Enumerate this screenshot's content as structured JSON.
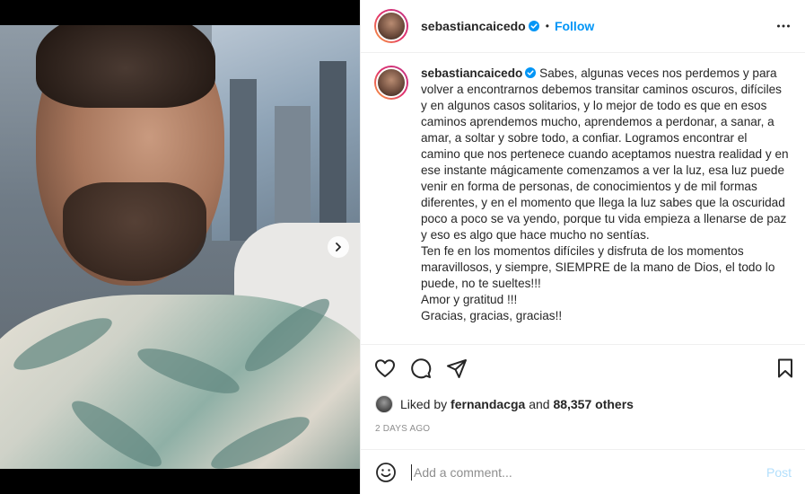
{
  "post": {
    "username": "sebastiancaicedo",
    "verified_icon": "verified-badge-icon",
    "separator": "•",
    "follow_label": "Follow",
    "more_icon": "more-horizontal-icon",
    "caption": "Sabes, algunas veces nos perdemos y para volver a encontrarnos debemos transitar caminos oscuros, difíciles y en algunos casos solitarios, y lo mejor de todo es que en esos caminos aprendemos mucho, aprendemos a perdonar, a sanar, a amar, a soltar y sobre todo, a confiar. Logramos encontrar el camino que nos pertenece cuando aceptamos nuestra realidad y en ese instante mágicamente comenzamos a ver la luz, esa luz puede venir en forma de personas, de conocimientos y de mil formas diferentes, y en el momento que llega la luz sabes que la oscuridad poco a poco se va yendo, porque tu vida empieza a llenarse de paz y eso es algo que hace mucho no sentías.\nTen fe en los momentos difíciles y disfruta de los momentos maravillosos, y siempre, SIEMPRE de la mano de Dios, el todo lo puede, no te sueltes!!!\nAmor y gratitud !!!\nGracias, gracias, gracias!!"
  },
  "likes": {
    "prefix": "Liked by",
    "liker": "fernandacga",
    "middle": "and",
    "others": "88,357 others"
  },
  "timestamp": "2 DAYS AGO",
  "comment": {
    "placeholder": "Add a comment...",
    "post_label": "Post"
  },
  "colors": {
    "accent": "#0095f6",
    "post_disabled": "#b2dffc",
    "muted": "#8e8e8e"
  }
}
